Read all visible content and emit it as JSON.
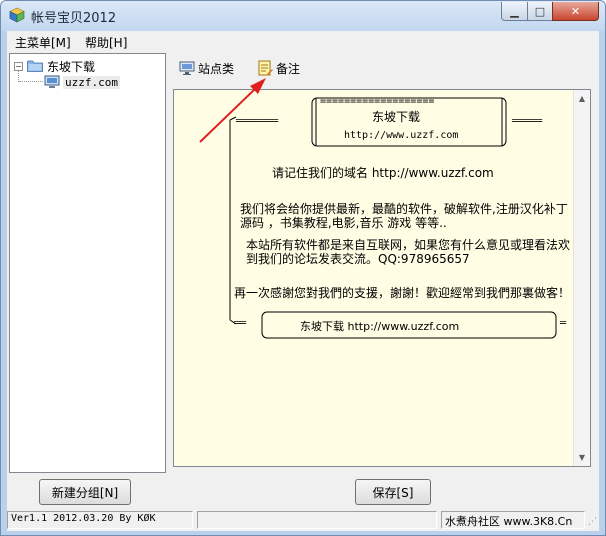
{
  "window": {
    "title": "帐号宝贝2012",
    "min_glyph": "▁",
    "max_glyph": "□",
    "close_glyph": "✕"
  },
  "menu": [
    "主菜单[M]",
    "帮助[H]"
  ],
  "tree": {
    "expander": "−",
    "root_label": "东坡下载",
    "child_label": "uzzf.com"
  },
  "toolbar": {
    "sites_label": "站点类",
    "notes_label": "备注"
  },
  "notes": {
    "top_rule": "===================",
    "brand_top": "东坡下载",
    "url_top": "http://www.uzzf.com",
    "left_bar": "═══════",
    "right_bar": "═════",
    "remember": "请记住我们的域名 http://www.uzzf.com",
    "line1": "我们将会给你提供最新，最酷的软件，破解软件,注册汉化补丁",
    "line2": "源码 ，书集教程,电影,音乐 游戏 等等..",
    "line3": "本站所有软件都是来自互联网，如果您有什么意见或理看法欢",
    "line4": "到我们的论坛发表交流。QQ:978965657",
    "thanks": "再一次感謝您對我們的支援，謝謝！歡迎經常到我們那裏做客！",
    "bottom_left_bar": "══",
    "bottom_right_bar": "═",
    "bottom_text": "东坡下载 http://www.uzzf.com",
    "scroll_up": "▲",
    "scroll_down": "▼"
  },
  "buttons": {
    "new_group": "新建分组[N]",
    "save": "保存[S]"
  },
  "status": {
    "version": "Ver1.1 2012.03.20 By KØK",
    "middle": "",
    "right": "水煮舟社区 www.3K8.Cn"
  },
  "colors": {
    "notes_bg": "#fffde4",
    "annotation_arrow": "#e02020"
  }
}
